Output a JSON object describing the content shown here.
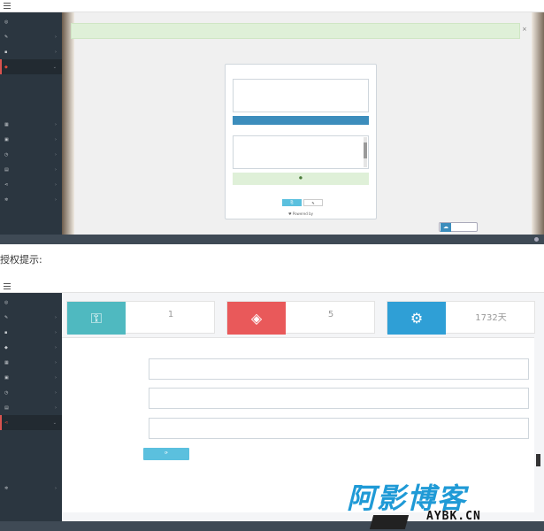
{
  "screen1": {
    "app_title": "",
    "user_menu": "",
    "sidebar_items": [
      {
        "label": "",
        "icon": "dashboard-icon"
      },
      {
        "label": "",
        "icon": "wrench-icon"
      },
      {
        "label": "",
        "icon": "cart-icon"
      },
      {
        "label": "",
        "icon": "shield-icon",
        "active": true
      },
      {
        "label": "",
        "icon": "product-icon"
      },
      {
        "label": "",
        "icon": "box-icon"
      },
      {
        "label": "",
        "icon": "clock-icon"
      },
      {
        "label": "",
        "icon": "chart-icon"
      },
      {
        "label": "",
        "icon": "share-icon"
      },
      {
        "label": "",
        "icon": "gear-icon"
      }
    ],
    "sub_items": [
      {
        "label": ""
      },
      {
        "label": ""
      },
      {
        "label": ""
      },
      {
        "label": "",
        "active": true
      }
    ],
    "alert": "",
    "panel": {
      "input_title": "",
      "input_placeholder": "",
      "encrypt_button": "",
      "result_title": "",
      "result_lines": [
        "",
        "",
        "",
        ""
      ],
      "tip": "",
      "copy_button": "",
      "edit_button": "",
      "powered_by": "Powered by"
    },
    "upload_button": "",
    "footer": ""
  },
  "section_heading": "授权提示:",
  "screen2": {
    "app_title": "",
    "user_menu": "",
    "sidebar_items": [
      {
        "label": "",
        "icon": "dashboard-icon"
      },
      {
        "label": "",
        "icon": "wrench-icon"
      },
      {
        "label": "",
        "icon": "cart-icon"
      },
      {
        "label": "",
        "icon": "shield-icon"
      },
      {
        "label": "",
        "icon": "product-icon"
      },
      {
        "label": "",
        "icon": "box-icon"
      },
      {
        "label": "",
        "icon": "clock-icon"
      },
      {
        "label": "",
        "icon": "chart-icon"
      },
      {
        "label": "",
        "icon": "share-icon",
        "active": true
      },
      {
        "label": "",
        "icon": "gear-icon"
      }
    ],
    "sub_items": [
      {
        "label": ""
      },
      {
        "label": "",
        "active": true
      },
      {
        "label": ""
      },
      {
        "label": ""
      }
    ],
    "stats": [
      {
        "value": "1",
        "label": "",
        "color": "#4fb9c0",
        "icon": "key-icon"
      },
      {
        "value": "5",
        "label": "",
        "color": "#e9595a",
        "icon": "tag-icon"
      },
      {
        "value": "1732天",
        "label": "",
        "color": "#2f9fd6",
        "icon": "gears-icon"
      }
    ],
    "form": {
      "title": "",
      "rows": [
        {
          "label": "",
          "value": ""
        },
        {
          "label": "",
          "value": ""
        },
        {
          "label": "",
          "value": ""
        }
      ],
      "save_button": ""
    },
    "footer": ""
  },
  "watermark": {
    "big": "阿影博客",
    "small": "AYBK.CN"
  },
  "colors": {
    "sidebar": "#2b3640",
    "accent_red": "#d9534f",
    "primary_blue": "#3c8dbc",
    "success_bg": "#dff0d8"
  }
}
